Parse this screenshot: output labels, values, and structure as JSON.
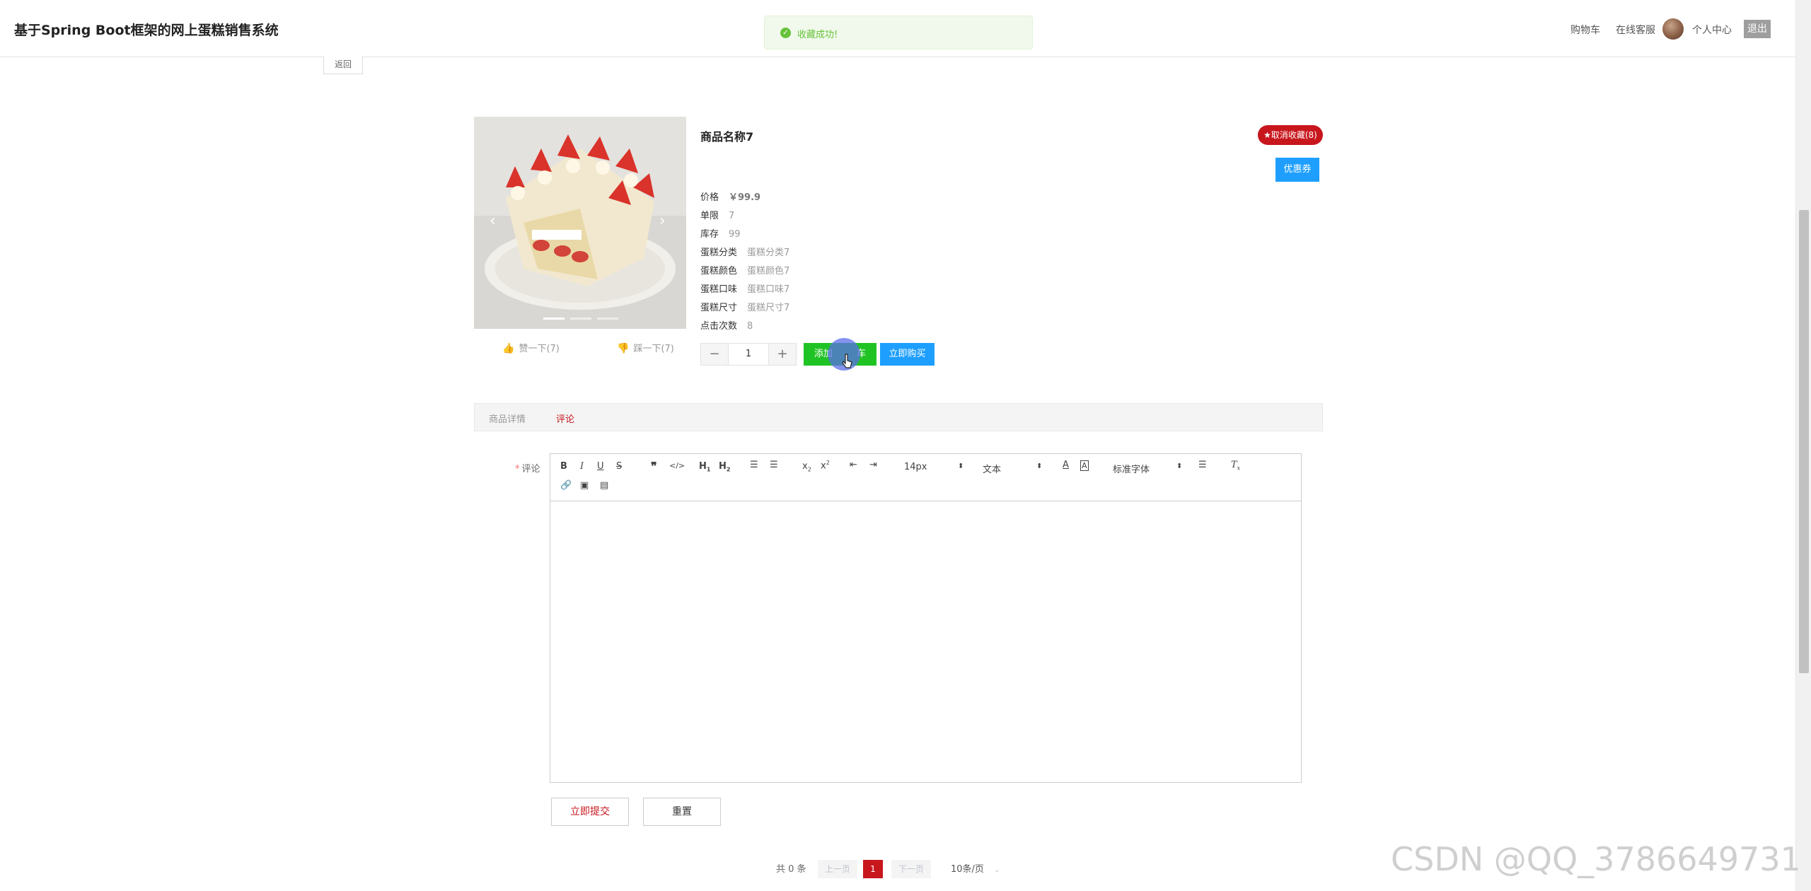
{
  "header": {
    "site_title": "基于Spring Boot框架的网上蛋糕销售系统",
    "nav": {
      "cart": "购物车",
      "service": "在线客服",
      "profile": "个人中心",
      "logout": "退出"
    }
  },
  "toast": {
    "message": "收藏成功!",
    "status_color": "#67c23a"
  },
  "back_label": "返回",
  "product": {
    "name": "商品名称7",
    "favorite_label": "★取消收藏(8)",
    "coupon_label": "优惠券",
    "attributes": [
      {
        "label": "价格",
        "value": "￥99.9"
      },
      {
        "label": "单限",
        "value": "7"
      },
      {
        "label": "库存",
        "value": "99"
      },
      {
        "label": "蛋糕分类",
        "value": "蛋糕分类7"
      },
      {
        "label": "蛋糕颜色",
        "value": "蛋糕颜色7"
      },
      {
        "label": "蛋糕口味",
        "value": "蛋糕口味7"
      },
      {
        "label": "蛋糕尺寸",
        "value": "蛋糕尺寸7"
      },
      {
        "label": "点击次数",
        "value": "8"
      }
    ],
    "like_label": "赞一下(7)",
    "dislike_label": "踩一下(7)",
    "quantity": "1",
    "add_to_cart_label": "添加到购物车",
    "add_to_cart_visible": "添加",
    "add_to_cart_tail": "车",
    "buy_now_label": "立即购买",
    "carousel": {
      "slides": 3,
      "active": 1
    }
  },
  "tabs": {
    "detail": "商品详情",
    "review": "评论",
    "active": "review"
  },
  "comment_form": {
    "label": "评论",
    "required_mark": "*",
    "font_size": "14px",
    "block_type": "文本",
    "font_family_label": "标准字体",
    "submit_label": "立即提交",
    "reset_label": "重置"
  },
  "pagination": {
    "total_text": "共 0 条",
    "prev_label": "上一页",
    "current_page": "1",
    "next_label": "下一页",
    "page_size_label": "10条/页"
  },
  "watermark": "CSDN @QQ_3786649731",
  "colors": {
    "brand_red": "#c8161d",
    "primary_blue": "#1e9fff",
    "cart_green": "#20c324"
  }
}
